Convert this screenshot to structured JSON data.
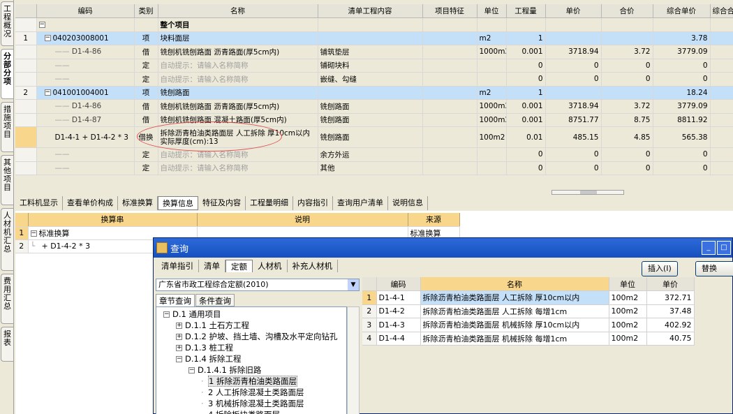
{
  "left_tabs": [
    "工程概况",
    "分部分项",
    "措施项目",
    "其他项目",
    "人材机汇总",
    "费用汇总",
    "报表"
  ],
  "grid": {
    "headers": [
      "",
      "编码",
      "类别",
      "名称",
      "清单工程内容",
      "项目特征",
      "单位",
      "工程量",
      "单价",
      "合价",
      "综合单价",
      "综合合"
    ],
    "top_row": {
      "label": "整个项目"
    },
    "rows": [
      {
        "rn": "1",
        "code": "040203008001",
        "type": "项",
        "name": "块料面层",
        "content": "",
        "unit": "m2",
        "qty": "1",
        "price": "",
        "total": "",
        "comp": "3.78",
        "kind": "parent"
      },
      {
        "rn": "",
        "code": "D1-4-86",
        "type": "借",
        "name": "铣刨机铣刨路面 沥青路面(厚5cm内)",
        "content": "铺筑垫层",
        "unit": "1000m2",
        "qty": "0.001",
        "price": "3718.94",
        "total": "3.72",
        "comp": "3779.09",
        "kind": "child"
      },
      {
        "rn": "",
        "code": "",
        "type": "定",
        "name": "自动提示：请输入名称简称",
        "content": "铺砌块料",
        "unit": "",
        "qty": "0",
        "price": "0",
        "total": "0",
        "comp": "0",
        "kind": "hint"
      },
      {
        "rn": "",
        "code": "",
        "type": "定",
        "name": "自动提示：请输入名称简称",
        "content": "嵌缝、勾缝",
        "unit": "",
        "qty": "0",
        "price": "0",
        "total": "0",
        "comp": "0",
        "kind": "hint"
      },
      {
        "rn": "2",
        "code": "041001004001",
        "type": "项",
        "name": "铣刨路面",
        "content": "",
        "unit": "m2",
        "qty": "1",
        "price": "",
        "total": "",
        "comp": "18.24",
        "kind": "parent"
      },
      {
        "rn": "",
        "code": "D1-4-86",
        "type": "借",
        "name": "铣刨机铣刨路面 沥青路面(厚5cm内)",
        "content": "铣刨路面",
        "unit": "1000m2",
        "qty": "0.001",
        "price": "3718.94",
        "total": "3.72",
        "comp": "3779.09",
        "kind": "child"
      },
      {
        "rn": "",
        "code": "D1-4-87",
        "type": "借",
        "name": "铣刨机铣刨路面 混凝土路面(厚5cm内)",
        "content": "铣刨路面",
        "unit": "1000m2",
        "qty": "0.001",
        "price": "8751.77",
        "total": "8.75",
        "comp": "8811.92",
        "kind": "child"
      },
      {
        "rn": "",
        "code": "D1-4-1 + D1-4-2 * 3",
        "type": "借换",
        "name": "拆除沥青柏油类路面层 人工拆除 厚10cm以内 实际厚度(cm):13",
        "content": "铣刨路面",
        "unit": "100m2",
        "qty": "0.01",
        "price": "485.15",
        "total": "4.85",
        "comp": "565.38",
        "kind": "tall"
      },
      {
        "rn": "",
        "code": "",
        "type": "定",
        "name": "自动提示：请输入名称简称",
        "content": "余方外运",
        "unit": "",
        "qty": "0",
        "price": "0",
        "total": "0",
        "comp": "0",
        "kind": "hint"
      },
      {
        "rn": "",
        "code": "",
        "type": "定",
        "name": "自动提示：请输入名称简称",
        "content": "其他",
        "unit": "",
        "qty": "0",
        "price": "0",
        "total": "0",
        "comp": "0",
        "kind": "hint"
      }
    ]
  },
  "bottom_tabs": [
    "工料机显示",
    "查看单价构成",
    "标准换算",
    "换算信息",
    "特征及内容",
    "工程量明细",
    "内容指引",
    "查询用户清单",
    "说明信息"
  ],
  "bottom_grid": {
    "headers": [
      "",
      "换算串",
      "说明",
      "来源"
    ],
    "rows": [
      {
        "rn": "1",
        "text": "标准换算",
        "desc": "",
        "src": "标准换算"
      },
      {
        "rn": "2",
        "text": "+ D1-4-2 * 3",
        "desc": "",
        "src": ""
      }
    ]
  },
  "dialog": {
    "title": "查询",
    "tabs": [
      "清单指引",
      "清单",
      "定额",
      "人材机",
      "补充人材机"
    ],
    "insert_btn": "插入(I)",
    "replace_btn": "替换(R)",
    "select_value": "广东省市政工程综合定额(2010)",
    "sub_tabs": [
      "章节查询",
      "条件查询"
    ],
    "tree": [
      "D.1 通用项目",
      "D.1.1 土石方工程",
      "D.1.2 护坡、挡土墙、沟槽及水平定向钻孔",
      "D.1.3 桩工程",
      "D.1.4  拆除工程",
      "D.1.4.1 拆除旧路",
      "1 拆除沥青柏油类路面层",
      "2 人工拆除混凝土类路面层",
      "3 机械拆除混凝土类路面层",
      "4 拆除板块类路面层"
    ],
    "result_headers": [
      "",
      "编码",
      "名称",
      "单位",
      "单价"
    ],
    "results": [
      {
        "rn": "1",
        "code": "D1-4-1",
        "name": "拆除沥青柏油类路面层 人工拆除 厚10cm以内",
        "unit": "100m2",
        "price": "372.71"
      },
      {
        "rn": "2",
        "code": "D1-4-2",
        "name": "拆除沥青柏油类路面层 人工拆除 每增1cm",
        "unit": "100m2",
        "price": "37.48"
      },
      {
        "rn": "3",
        "code": "D1-4-3",
        "name": "拆除沥青柏油类路面层 机械拆除 厚10cm以内",
        "unit": "100m2",
        "price": "402.92"
      },
      {
        "rn": "4",
        "code": "D1-4-4",
        "name": "拆除沥青柏油类路面层 机械拆除 每增1cm",
        "unit": "100m2",
        "price": "40.75"
      }
    ]
  }
}
